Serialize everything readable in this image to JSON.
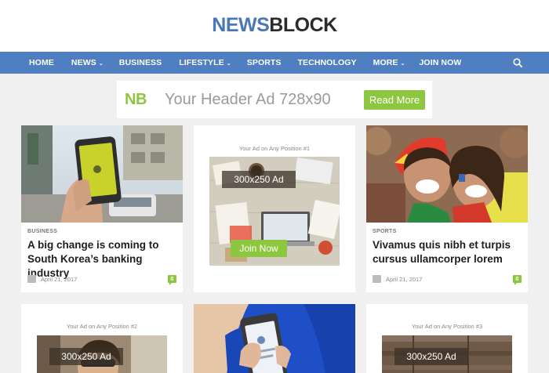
{
  "site": {
    "logo_part1": "NEWS",
    "logo_part2": "BLOCK"
  },
  "nav": {
    "items": [
      {
        "label": "HOME",
        "dropdown": false
      },
      {
        "label": "NEWS",
        "dropdown": true
      },
      {
        "label": "BUSINESS",
        "dropdown": false
      },
      {
        "label": "LIFESTYLE",
        "dropdown": true
      },
      {
        "label": "SPORTS",
        "dropdown": false
      },
      {
        "label": "TECHNOLOGY",
        "dropdown": false
      },
      {
        "label": "MORE",
        "dropdown": true
      },
      {
        "label": "JOIN NOW",
        "dropdown": false
      }
    ],
    "chevron": "⌄",
    "search_icon": "search-icon"
  },
  "header_ad": {
    "logo": "NB",
    "text": "Your Header Ad 728x90",
    "button": "Read More"
  },
  "cards": [
    {
      "category": "BUSINESS",
      "title": "A big change is coming to South Korea’s banking industry",
      "date": "April 21, 2017",
      "comments": "0"
    },
    {
      "ad_label": "Your Ad on Any Position #1",
      "ad_size": "300x250 Ad",
      "ad_button": "Join Now"
    },
    {
      "category": "SPORTS",
      "title": "Vivamus quis nibh et turpis cursus ullamcorper lorem",
      "date": "April 21, 2017",
      "comments": "0"
    },
    {
      "ad_label": "Your Ad on Any Position #2",
      "ad_size": "300x250 Ad"
    },
    {},
    {
      "ad_label": "Your Ad on Any Position #3",
      "ad_size": "300x250 Ad"
    }
  ],
  "colors": {
    "accent_blue": "#4f7ec1",
    "accent_green": "#8dc63f"
  }
}
